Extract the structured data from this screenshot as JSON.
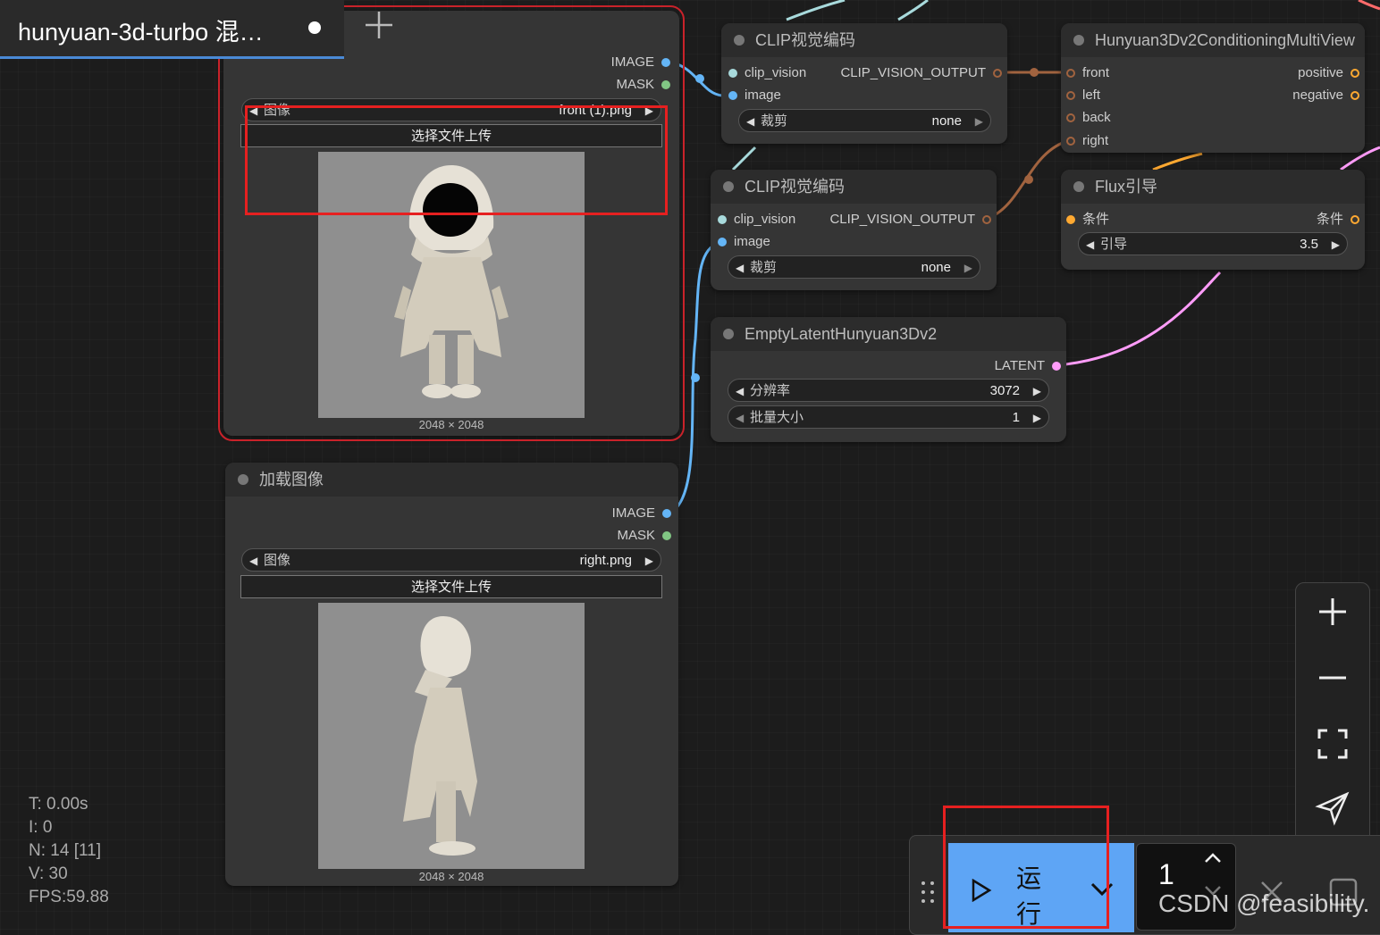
{
  "tab": {
    "title": "hunyuan-3d-turbo  混…",
    "new_tab_icon": "plus-icon"
  },
  "colors": {
    "clip_vision": "#a8dadc",
    "image": "#64b5f6",
    "mask": "#81c784",
    "clip_vision_output": "#a1633f",
    "conditioning": "#ffa931",
    "latent": "#ff9cf9",
    "highlight": "#e62020",
    "run": "#5ea5f5"
  },
  "load_image_1": {
    "out_image": "IMAGE",
    "out_mask": "MASK",
    "widget_label": "图像",
    "widget_value": "front (1).png",
    "upload": "选择文件上传",
    "dims": "2048 × 2048"
  },
  "load_image_2": {
    "title": "加载图像",
    "out_image": "IMAGE",
    "out_mask": "MASK",
    "widget_label": "图像",
    "widget_value": "right.png",
    "upload": "选择文件上传",
    "dims": "2048 × 2048"
  },
  "clip_encode_1": {
    "title": "CLIP视觉编码",
    "in_clip": "clip_vision",
    "in_image": "image",
    "out": "CLIP_VISION_OUTPUT",
    "widget_label": "裁剪",
    "widget_value": "none"
  },
  "clip_encode_2": {
    "title": "CLIP视觉编码",
    "in_clip": "clip_vision",
    "in_image": "image",
    "out": "CLIP_VISION_OUTPUT",
    "widget_label": "裁剪",
    "widget_value": "none"
  },
  "conditioning_multiview": {
    "title": "Hunyuan3Dv2ConditioningMultiView",
    "in_front": "front",
    "in_left": "left",
    "in_back": "back",
    "in_right": "right",
    "out_positive": "positive",
    "out_negative": "negative"
  },
  "flux_guidance": {
    "title": "Flux引导",
    "in": "条件",
    "out": "条件",
    "widget_label": "引导",
    "widget_value": "3.5"
  },
  "empty_latent": {
    "title": "EmptyLatentHunyuan3Dv2",
    "out": "LATENT",
    "res_label": "分辨率",
    "res_value": "3072",
    "batch_label": "批量大小",
    "batch_value": "1"
  },
  "stats": {
    "t": "T: 0.00s",
    "i": "I: 0",
    "n": "N: 14 [11]",
    "v": "V: 30",
    "fps": "FPS:59.88"
  },
  "zoom": [
    "zoom-in-icon",
    "zoom-out-icon",
    "fit-view-icon",
    "select-pointer-icon"
  ],
  "run": {
    "label_1": "运",
    "label_2": "行",
    "queue_count": "1"
  },
  "watermark": "CSDN @feasibility."
}
